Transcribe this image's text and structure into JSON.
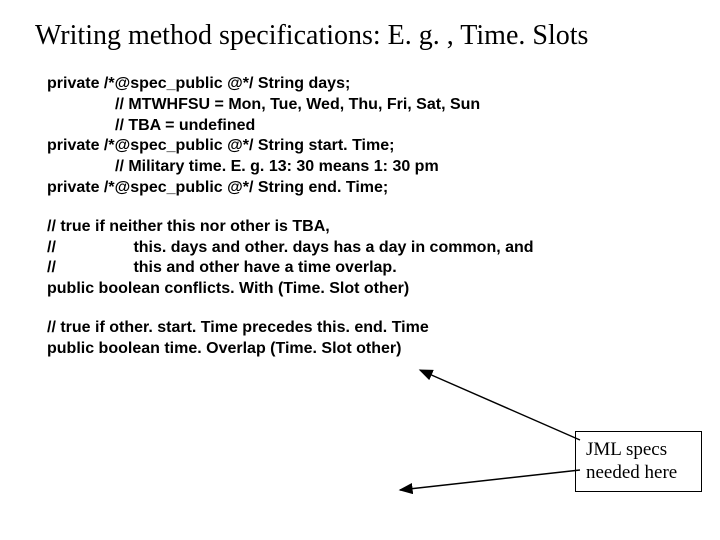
{
  "title": "Writing method specifications: E. g. , Time. Slots",
  "decl1": {
    "line": "private /*@spec_public @*/ String days;",
    "c1": "// MTWHFSU = Mon, Tue, Wed, Thu, Fri, Sat, Sun",
    "c2": "// TBA = undefined"
  },
  "decl2": {
    "line": "private /*@spec_public @*/ String start. Time;",
    "c1": "// Military time. E. g. 13: 30 means 1: 30 pm"
  },
  "decl3": {
    "line": "private /*@spec_public @*/ String end. Time;"
  },
  "method1": {
    "c1": "// true if neither this nor other is TBA,",
    "c2p": "//",
    "c2": "this. days and other. days has a day in common, and",
    "c3p": "//",
    "c3": "this and other have a time overlap.",
    "sig": "public boolean conflicts. With (Time. Slot other)"
  },
  "method2": {
    "c1": "// true if other. start. Time precedes this. end. Time",
    "sig": "public boolean time. Overlap (Time. Slot other)"
  },
  "callout": {
    "l1": "JML specs",
    "l2": "needed here"
  }
}
